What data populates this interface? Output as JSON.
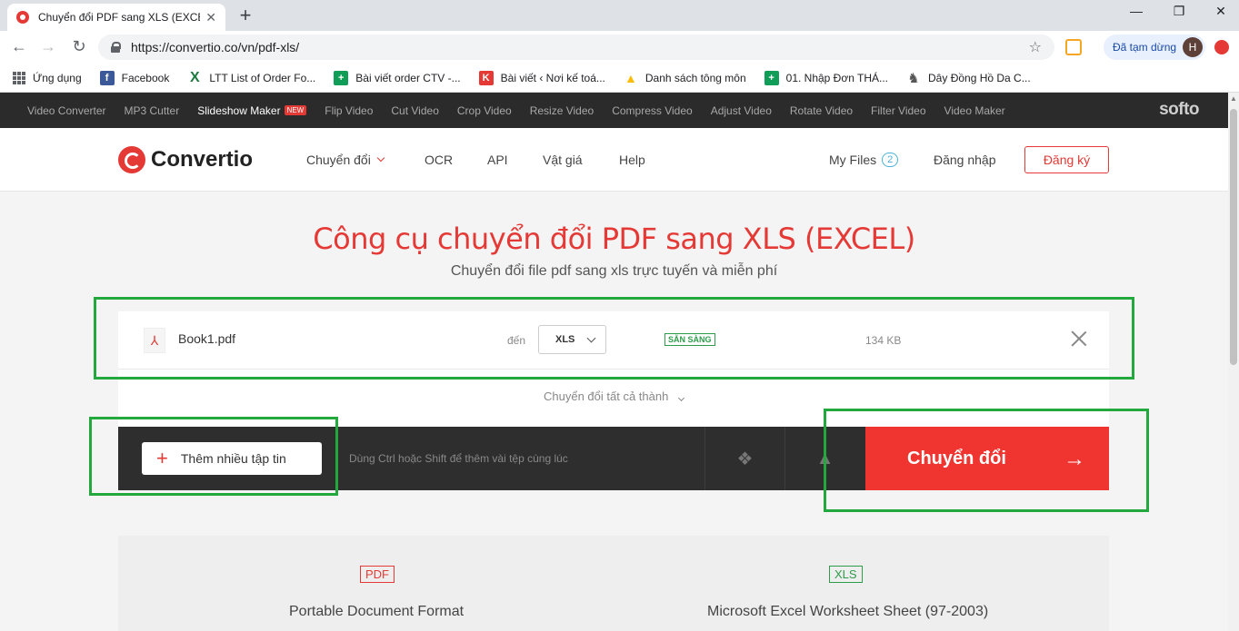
{
  "browser": {
    "tab_title": "Chuyển đổi PDF sang XLS (EXCEL",
    "tab_close": "✕",
    "new_tab": "+",
    "window_controls": {
      "minimize": "—",
      "maximize": "❐",
      "close": "✕"
    },
    "nav": {
      "back": "←",
      "forward": "→",
      "reload": "↻"
    },
    "url": "https://convertio.co/vn/pdf-xls/",
    "star": "☆",
    "paused_label": "Đã tạm dừng",
    "avatar_letter": "H"
  },
  "bookmarks": [
    {
      "label": "Ứng dụng",
      "icon": "apps-grid-icon"
    },
    {
      "label": "Facebook",
      "icon": "facebook-icon",
      "color": "#3b5998",
      "glyph": "f"
    },
    {
      "label": "LTT List of Order Fo...",
      "icon": "excel-x-icon",
      "color": "#1d7a3f",
      "glyph": "X"
    },
    {
      "label": "Bài viết order CTV -...",
      "icon": "sheets-icon",
      "color": "#0f9d58",
      "glyph": "+"
    },
    {
      "label": "Bài viết ‹ Nơi kế toá...",
      "icon": "k-icon",
      "color": "#e53935",
      "glyph": "K"
    },
    {
      "label": "Danh sách tông môn",
      "icon": "drive-icon",
      "color": "#fbbc05",
      "glyph": "▲"
    },
    {
      "label": "01. Nhập Đơn THÁ...",
      "icon": "sheets-icon",
      "color": "#0f9d58",
      "glyph": "+"
    },
    {
      "label": "Dây Đồng Hồ Da C...",
      "icon": "horse-icon",
      "color": "#555555",
      "glyph": "♞"
    }
  ],
  "softo_bar": {
    "items": [
      "Video Converter",
      "MP3 Cutter",
      "Slideshow Maker",
      "Flip Video",
      "Cut Video",
      "Crop Video",
      "Resize Video",
      "Compress Video",
      "Adjust Video",
      "Rotate Video",
      "Filter Video",
      "Video Maker"
    ],
    "new_badge": "NEW",
    "logo": "softo"
  },
  "header": {
    "logo": "Convertio",
    "nav": {
      "convert": "Chuyển đổi",
      "ocr": "OCR",
      "api": "API",
      "pricing": "Vật giá",
      "help": "Help"
    },
    "my_files": "My Files",
    "my_files_count": "2",
    "login": "Đăng nhập",
    "signup": "Đăng ký"
  },
  "hero": {
    "title": "Công cụ chuyển đổi PDF sang XLS (EXCEL)",
    "subtitle": "Chuyển đổi file pdf sang xls trực tuyến và miễn phí"
  },
  "file": {
    "name": "Book1.pdf",
    "to_label": "đến",
    "target_format": "XLS",
    "status": "SẴN SÀNG",
    "size": "134 KB"
  },
  "convert_all": "Chuyển đổi tất cả thành",
  "actions": {
    "add_files": "Thêm nhiều tập tin",
    "hint": "Dùng Ctrl hoặc Shift để thêm vài tệp cùng lúc",
    "convert": "Chuyển đổi",
    "convert_arrow": "→"
  },
  "formats": {
    "from_tag": "PDF",
    "from_name": "Portable Document Format",
    "to_tag": "XLS",
    "to_name": "Microsoft Excel Worksheet Sheet (97-2003)"
  },
  "colors": {
    "accent": "#e53935",
    "highlight": "#22a83d",
    "ready": "#2e9d4a"
  }
}
